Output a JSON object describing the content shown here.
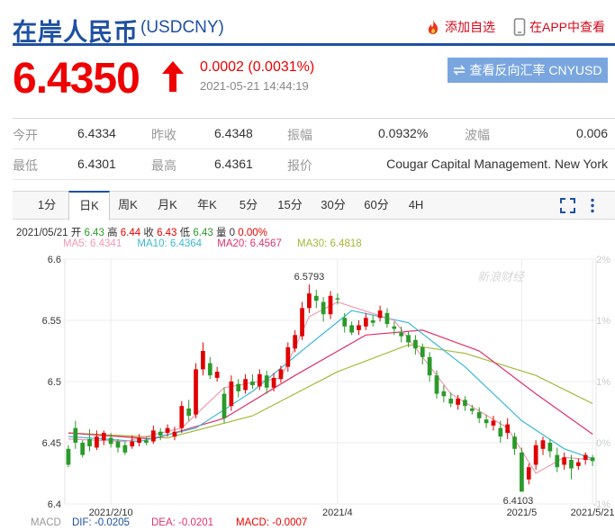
{
  "header": {
    "title": "在岸人民币",
    "symbol": "(USDCNY)",
    "add_watchlist": "添加自选",
    "view_in_app": "在APP中查看"
  },
  "quote": {
    "price": "6.4350",
    "change": "0.0002 (0.0031%)",
    "timestamp": "2021-05-21 14:44:19",
    "reverse_button": "查看反向汇率 CNYUSD"
  },
  "stats": {
    "row1": [
      {
        "label": "今开",
        "value": "6.4334"
      },
      {
        "label": "昨收",
        "value": "6.4348"
      },
      {
        "label": "振幅",
        "value": "0.0932%"
      },
      {
        "label": "波幅",
        "value": "0.006"
      }
    ],
    "row2": [
      {
        "label": "最低",
        "value": "6.4301"
      },
      {
        "label": "最高",
        "value": "6.4361"
      },
      {
        "label": "报价",
        "value": "Cougar Capital Management. New York"
      }
    ]
  },
  "tabs": [
    "1分",
    "日K",
    "周K",
    "月K",
    "年K",
    "5分",
    "15分",
    "30分",
    "60分",
    "4H"
  ],
  "active_tab": "日K",
  "ohlc_info": {
    "date": "2021/05/21",
    "open_label": "开",
    "open": "6.43",
    "high_label": "高",
    "high": "6.44",
    "close_label": "收",
    "close": "6.43",
    "low_label": "低",
    "low": "6.43",
    "vol_label": "量",
    "vol": "0",
    "pct": "0.00%"
  },
  "ma_legend": {
    "ma5": "MA5: 6.4341",
    "ma10": "MA10: 6.4364",
    "ma20": "MA20: 6.4567",
    "ma30": "MA30: 6.4818"
  },
  "macd_legend": {
    "macd": "MACD",
    "dif": "DIF: -0.0205",
    "dea": "DEA: -0.0201",
    "macd_val": "MACD: -0.0007"
  },
  "watermark": "新浪财经",
  "colors": {
    "brand": "#1e50a2",
    "up": "#e00000",
    "down": "#2a9a2a",
    "ma5": "#f29ab0",
    "ma10": "#3bb8d8",
    "ma20": "#e0336a",
    "ma30": "#a6b83a"
  },
  "chart_data": {
    "type": "candlestick",
    "yticks": [
      "6.6",
      "6.55",
      "6.5",
      "6.45",
      "6.4"
    ],
    "y_ticks_right": [
      "2%",
      "1%",
      "1%",
      "0%",
      "-1%"
    ],
    "x_ticks": [
      "2021/2/10",
      "2021/4",
      "2021/5",
      "2021/5/21"
    ],
    "annotations": [
      {
        "text": "6.5793"
      },
      {
        "text": "6.4103"
      }
    ],
    "ylim": [
      6.4,
      6.6
    ],
    "candles": [
      [
        6.445,
        6.432,
        6.448,
        6.43
      ],
      [
        6.462,
        6.45,
        6.468,
        6.445
      ],
      [
        6.45,
        6.44,
        6.452,
        6.438
      ],
      [
        6.453,
        6.447,
        6.461,
        6.443
      ],
      [
        6.446,
        6.455,
        6.46,
        6.444
      ],
      [
        6.452,
        6.458,
        6.46,
        6.448
      ],
      [
        6.454,
        6.449,
        6.458,
        6.446
      ],
      [
        6.451,
        6.446,
        6.453,
        6.442
      ],
      [
        6.448,
        6.442,
        6.451,
        6.44
      ],
      [
        6.447,
        6.451,
        6.456,
        6.445
      ],
      [
        6.45,
        6.454,
        6.457,
        6.447
      ],
      [
        6.452,
        6.45,
        6.455,
        6.448
      ],
      [
        6.451,
        6.46,
        6.464,
        6.449
      ],
      [
        6.459,
        6.456,
        6.462,
        6.452
      ],
      [
        6.458,
        6.462,
        6.465,
        6.455
      ],
      [
        6.455,
        6.459,
        6.463,
        6.452
      ],
      [
        6.462,
        6.48,
        6.484,
        6.458
      ],
      [
        6.478,
        6.472,
        6.485,
        6.468
      ],
      [
        6.473,
        6.51,
        6.515,
        6.47
      ],
      [
        6.51,
        6.525,
        6.532,
        6.505
      ],
      [
        6.515,
        6.505,
        6.52,
        6.502
      ],
      [
        6.503,
        6.508,
        6.512,
        6.5
      ],
      [
        6.49,
        6.47,
        6.495,
        6.466
      ],
      [
        6.48,
        6.5,
        6.505,
        6.476
      ],
      [
        6.498,
        6.492,
        6.502,
        6.487
      ],
      [
        6.493,
        6.502,
        6.506,
        6.49
      ],
      [
        6.5,
        6.497,
        6.506,
        6.494
      ],
      [
        6.496,
        6.506,
        6.51,
        6.493
      ],
      [
        6.505,
        6.495,
        6.509,
        6.49
      ],
      [
        6.495,
        6.503,
        6.507,
        6.492
      ],
      [
        6.502,
        6.51,
        6.513,
        6.499
      ],
      [
        6.512,
        6.528,
        6.532,
        6.508
      ],
      [
        6.527,
        6.538,
        6.542,
        6.524
      ],
      [
        6.537,
        6.56,
        6.565,
        6.534
      ],
      [
        6.56,
        6.572,
        6.5793,
        6.556
      ],
      [
        6.57,
        6.566,
        6.575,
        6.56
      ],
      [
        6.565,
        6.555,
        6.569,
        6.549
      ],
      [
        6.555,
        6.57,
        6.574,
        6.551
      ],
      [
        6.568,
        6.567,
        6.572,
        6.563
      ],
      [
        6.552,
        6.545,
        6.556,
        6.54
      ],
      [
        6.546,
        6.54,
        6.549,
        6.538
      ],
      [
        6.542,
        6.546,
        6.55,
        6.538
      ],
      [
        6.545,
        6.552,
        6.556,
        6.542
      ],
      [
        6.55,
        6.548,
        6.554,
        6.545
      ],
      [
        6.552,
        6.558,
        6.562,
        6.549
      ],
      [
        6.556,
        6.547,
        6.56,
        6.544
      ],
      [
        6.545,
        6.543,
        6.549,
        6.538
      ],
      [
        6.54,
        6.537,
        6.545,
        6.532
      ],
      [
        6.538,
        6.532,
        6.541,
        6.528
      ],
      [
        6.534,
        6.527,
        6.538,
        6.522
      ],
      [
        6.528,
        6.52,
        6.531,
        6.514
      ],
      [
        6.52,
        6.505,
        6.524,
        6.5
      ],
      [
        6.505,
        6.49,
        6.509,
        6.486
      ],
      [
        6.492,
        6.488,
        6.497,
        6.483
      ],
      [
        6.486,
        6.482,
        6.491,
        6.479
      ],
      [
        6.481,
        6.486,
        6.489,
        6.477
      ],
      [
        6.485,
        6.48,
        6.488,
        6.476
      ],
      [
        6.478,
        6.476,
        6.481,
        6.473
      ],
      [
        6.475,
        6.47,
        6.479,
        6.466
      ],
      [
        6.469,
        6.466,
        6.473,
        6.462
      ],
      [
        6.464,
        6.468,
        6.472,
        6.46
      ],
      [
        6.462,
        6.455,
        6.468,
        6.45
      ],
      [
        6.458,
        6.465,
        6.47,
        6.453
      ],
      [
        6.455,
        6.445,
        6.458,
        6.44
      ],
      [
        6.442,
        6.41,
        6.446,
        6.4103
      ],
      [
        6.42,
        6.43,
        6.433,
        6.416
      ],
      [
        6.432,
        6.448,
        6.452,
        6.428
      ],
      [
        6.445,
        6.452,
        6.455,
        6.44
      ],
      [
        6.45,
        6.443,
        6.453,
        6.438
      ],
      [
        6.44,
        6.43,
        6.446,
        6.426
      ],
      [
        6.432,
        6.438,
        6.442,
        6.428
      ],
      [
        6.436,
        6.429,
        6.44,
        6.42
      ],
      [
        6.431,
        6.434,
        6.437,
        6.428
      ],
      [
        6.436,
        6.44,
        6.442,
        6.432
      ],
      [
        6.438,
        6.435,
        6.44,
        6.431
      ]
    ],
    "ma_lines": {
      "ma5": [
        [
          0,
          6.453
        ],
        [
          8,
          6.451
        ],
        [
          16,
          6.462
        ],
        [
          22,
          6.495
        ],
        [
          30,
          6.503
        ],
        [
          34,
          6.553
        ],
        [
          38,
          6.565
        ],
        [
          46,
          6.55
        ],
        [
          54,
          6.49
        ],
        [
          62,
          6.462
        ],
        [
          66,
          6.425
        ],
        [
          70,
          6.438
        ],
        [
          74,
          6.436
        ]
      ],
      "ma10": [
        [
          0,
          6.455
        ],
        [
          10,
          6.451
        ],
        [
          18,
          6.462
        ],
        [
          26,
          6.492
        ],
        [
          34,
          6.53
        ],
        [
          40,
          6.558
        ],
        [
          48,
          6.548
        ],
        [
          56,
          6.512
        ],
        [
          64,
          6.468
        ],
        [
          70,
          6.445
        ],
        [
          74,
          6.437
        ]
      ],
      "ma20": [
        [
          0,
          6.458
        ],
        [
          12,
          6.453
        ],
        [
          22,
          6.47
        ],
        [
          32,
          6.505
        ],
        [
          42,
          6.538
        ],
        [
          50,
          6.542
        ],
        [
          58,
          6.525
        ],
        [
          66,
          6.49
        ],
        [
          74,
          6.457
        ]
      ],
      "ma30": [
        [
          0,
          6.458
        ],
        [
          14,
          6.454
        ],
        [
          26,
          6.472
        ],
        [
          38,
          6.508
        ],
        [
          48,
          6.53
        ],
        [
          56,
          6.523
        ],
        [
          66,
          6.505
        ],
        [
          74,
          6.482
        ]
      ]
    }
  }
}
